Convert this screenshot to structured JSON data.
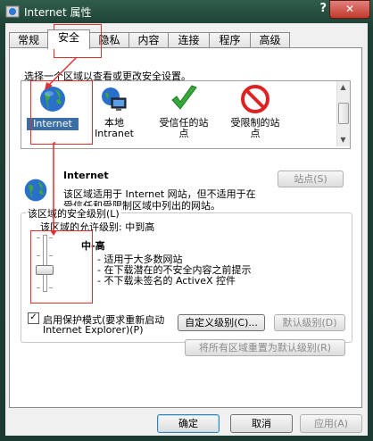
{
  "window": {
    "title": "Internet 属性",
    "help_label": "?",
    "close_label": "✕"
  },
  "tabs": [
    {
      "label": "常规",
      "active": false
    },
    {
      "label": "安全",
      "active": true
    },
    {
      "label": "隐私",
      "active": false
    },
    {
      "label": "内容",
      "active": false
    },
    {
      "label": "连接",
      "active": false
    },
    {
      "label": "程序",
      "active": false
    },
    {
      "label": "高级",
      "active": false
    }
  ],
  "security": {
    "select_zone_label": "选择一个区域以查看或更改安全设置。",
    "zones": [
      {
        "label": "Internet",
        "icon": "globe-icon",
        "selected": true
      },
      {
        "label": "本地 Intranet",
        "line1": "本地",
        "line2": "Intranet",
        "icon": "intranet-icon"
      },
      {
        "label": "受信任的站点",
        "line1": "受信任的站",
        "line2": "点",
        "icon": "trusted-checkmark-icon"
      },
      {
        "label": "受限制的站点",
        "line1": "受限制的站",
        "line2": "点",
        "icon": "restricted-no-entry-icon"
      }
    ],
    "zone_title": "Internet",
    "zone_desc_line1": "该区域适用于 Internet 网站，但不适用于在",
    "zone_desc_line2": "受信任和受限制区域中列出的网站。",
    "sites_button": "站点(S)",
    "level_group_label": "该区域的安全级别(L)",
    "allowed_levels": "该区域的允许级别: 中到高",
    "level_name": "中-高",
    "level_bullets": [
      "- 适用于大多数网站",
      "- 在下载潜在的不安全内容之前提示",
      "- 不下载未签名的 ActiveX 控件"
    ],
    "protected_mode_line1": "启用保护模式(要求重新启动",
    "protected_mode_line2": "Internet Explorer)(P)",
    "protected_mode_checked": true,
    "custom_level_button": "自定义级别(C)...",
    "default_level_button": "默认级别(D)",
    "reset_all_button": "将所有区域重置为默认级别(R)"
  },
  "footer": {
    "ok": "确定",
    "cancel": "取消",
    "apply": "应用(A)"
  },
  "colors": {
    "annotation": "#e03030",
    "selection": "#3a6ea5"
  }
}
